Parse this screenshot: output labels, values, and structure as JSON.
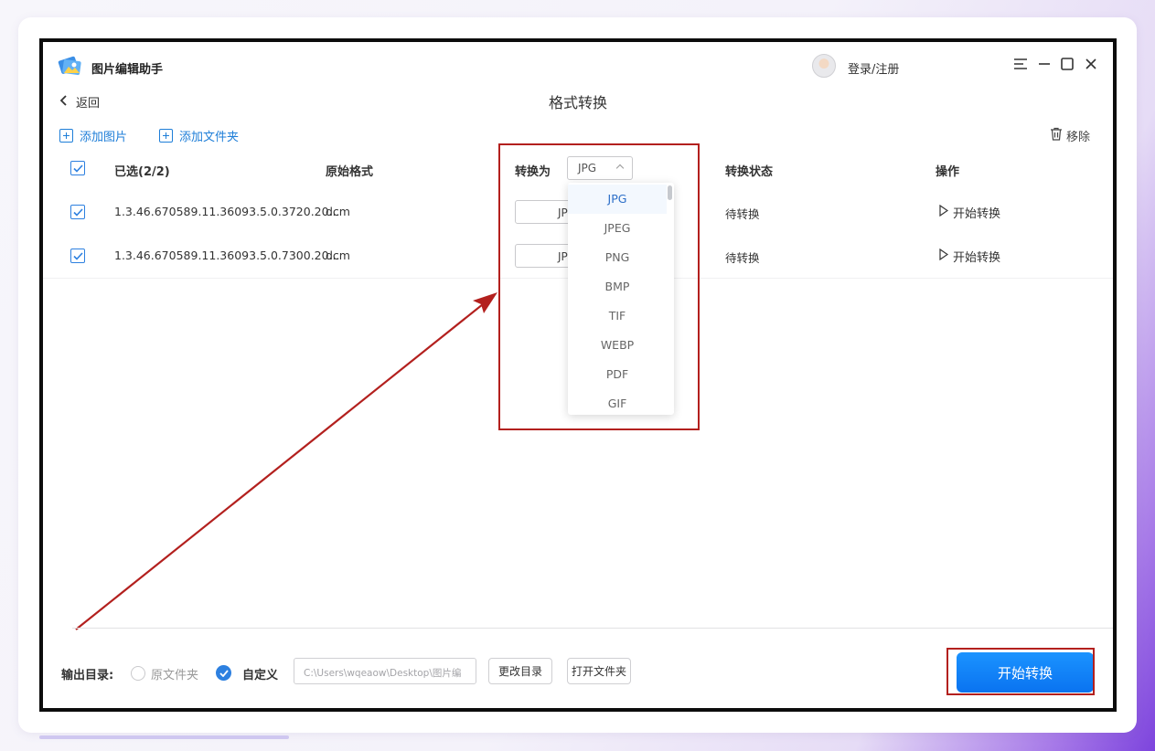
{
  "app": {
    "title": "图片编辑助手",
    "login_label": "登录/注册"
  },
  "nav": {
    "back_label": "返回",
    "page_title": "格式转换"
  },
  "toolbar": {
    "add_image": "添加图片",
    "add_folder": "添加文件夹",
    "remove": "移除"
  },
  "table": {
    "headers": {
      "selected": "已选(2/2)",
      "original_format": "原始格式",
      "convert_to": "转换为",
      "status": "转换状态",
      "action": "操作"
    },
    "rows": [
      {
        "name": "1.3.46.670589.11.36093.5.0.3720.20...",
        "format": "dcm",
        "target": "JPG",
        "status": "待转换",
        "action": "开始转换",
        "checked": true
      },
      {
        "name": "1.3.46.670589.11.36093.5.0.7300.20...",
        "format": "dcm",
        "target": "JPG",
        "status": "待转换",
        "action": "开始转换",
        "checked": true
      }
    ]
  },
  "format_select": {
    "value": "JPG",
    "options": [
      "JPG",
      "JPEG",
      "PNG",
      "BMP",
      "TIF",
      "WEBP",
      "PDF",
      "GIF"
    ]
  },
  "bottom": {
    "output_label": "输出目录:",
    "radio_original": "原文件夹",
    "radio_custom": "自定义",
    "path_value": "C:\\Users\\wqeaow\\Desktop\\图片编",
    "change_dir": "更改目录",
    "open_folder": "打开文件夹",
    "start_button": "开始转换"
  },
  "colors": {
    "accent": "#1e7ed8",
    "primary_button": "#0a73f0",
    "annotation_red": "#b3201e"
  },
  "icons": {
    "logo": "app-logo-icon",
    "avatar": "user-avatar-icon",
    "menu": "menu-icon",
    "minimize": "minimize-icon",
    "maximize": "maximize-icon",
    "close": "close-icon",
    "back": "chevron-left-icon",
    "add": "plus-square-icon",
    "trash": "trash-icon",
    "play": "play-icon",
    "check": "check-icon"
  }
}
